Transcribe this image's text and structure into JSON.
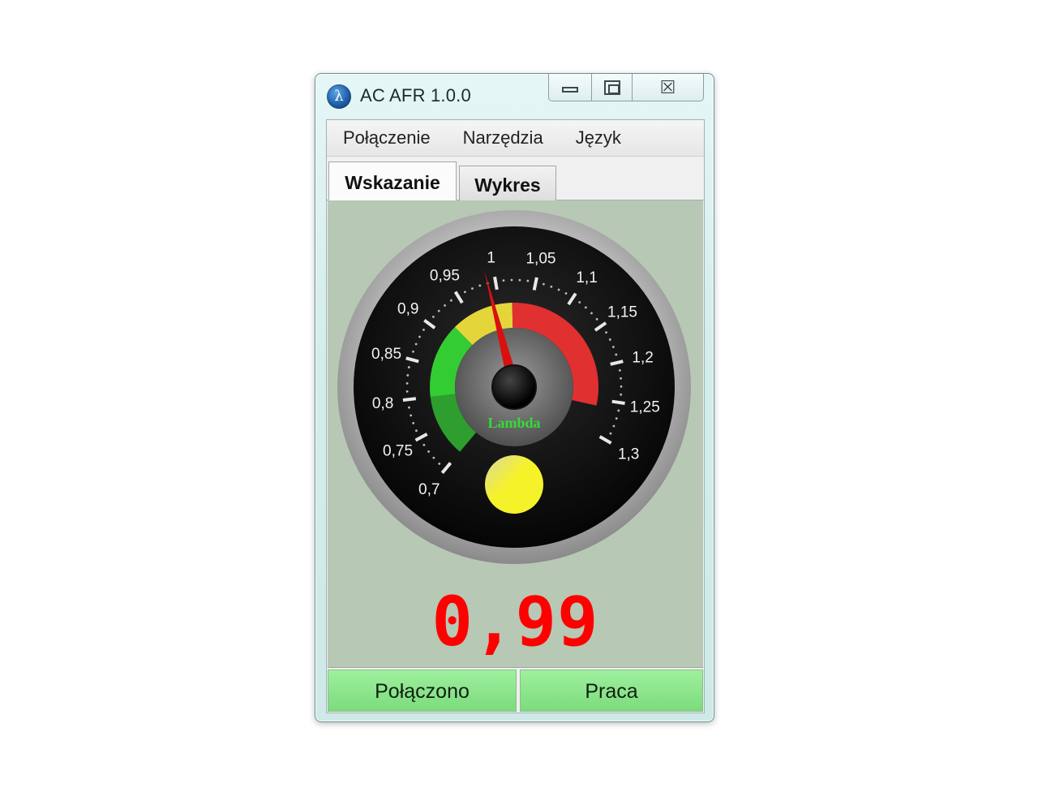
{
  "window": {
    "title": "AC AFR   1.0.0",
    "app_icon": "lambda-icon",
    "caption": {
      "minimize": "minimize-icon",
      "maximize": "maximize-icon",
      "close_glyph": "☒"
    }
  },
  "menu": [
    {
      "label": "Połączenie"
    },
    {
      "label": "Narzędzia"
    },
    {
      "label": "Język"
    }
  ],
  "tabs": [
    {
      "label": "Wskazanie",
      "active": true
    },
    {
      "label": "Wykres",
      "active": false
    }
  ],
  "gauge": {
    "min": 0.7,
    "max": 1.3,
    "value": 0.99,
    "unit_label": "Lambda",
    "tick_labels": [
      "0,7",
      "0,75",
      "0,8",
      "0,85",
      "0,9",
      "0,95",
      "1",
      "1,05",
      "1,1",
      "1,15",
      "1,2",
      "1,25",
      "1,3"
    ],
    "tick_values": [
      0.7,
      0.75,
      0.8,
      0.85,
      0.9,
      0.95,
      1.0,
      1.05,
      1.1,
      1.15,
      1.2,
      1.25,
      1.3
    ],
    "bands": [
      {
        "from": 0.7,
        "to": 0.8,
        "color": "#2e9e2e"
      },
      {
        "from": 0.8,
        "to": 0.92,
        "color": "#33cc33"
      },
      {
        "from": 0.92,
        "to": 1.02,
        "color": "#e4d63a"
      },
      {
        "from": 1.02,
        "to": 1.26,
        "color": "#e03030"
      }
    ],
    "indicator_color": "#f2ee2a",
    "needle_color": "#d81010"
  },
  "readout": {
    "value": "0,99",
    "color": "#ff0000"
  },
  "status": {
    "connection": "Połączono",
    "mode": "Praca"
  }
}
